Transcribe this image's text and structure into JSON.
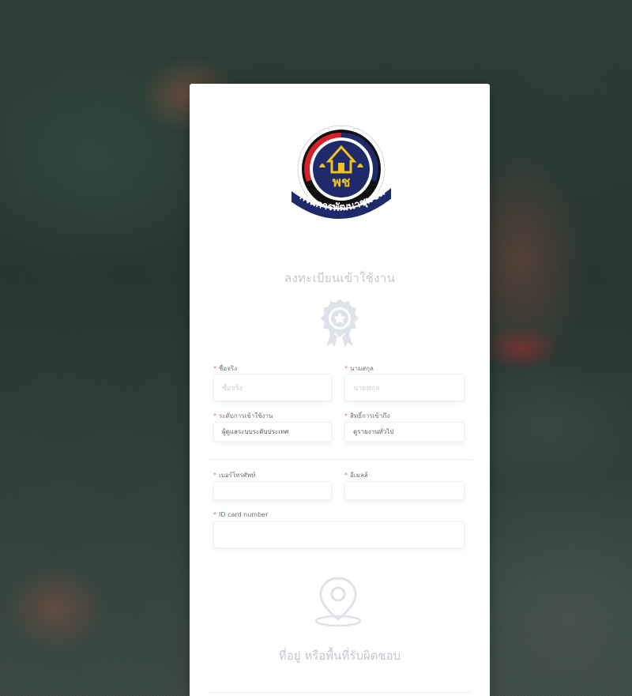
{
  "logo": {
    "text": "กรมการพัฒนาชุมชน",
    "emblem_text": "พช",
    "colors": {
      "navy": "#1f2a6b",
      "red": "#d8202a",
      "gold": "#f3c21a",
      "black": "#111111"
    }
  },
  "register_title": "ลงทะเบียนเข้าใช้งาน",
  "icons": {
    "award": "award-ribbon-icon",
    "location": "map-pin-icon"
  },
  "form": {
    "first_name": {
      "label": "ชื่อจริง",
      "placeholder": "ชื่อจริง",
      "required": "*"
    },
    "last_name": {
      "label": "นามสกุล",
      "placeholder": "นามสกุล",
      "required": "*"
    },
    "access_level": {
      "label": "ระดับการเข้าใช้งาน",
      "value": "ผู้ดูแลระบบระดับประเทศ",
      "required": "*"
    },
    "access_rights": {
      "label": "สิทธิ์การเข้าถึง",
      "value": "ดูรายงานทั่วไป",
      "required": "*"
    },
    "phone": {
      "label": "เบอร์โทรศัพท์",
      "value": "",
      "required": "*"
    },
    "email": {
      "label": "อีเมลล์",
      "value": "",
      "required": "*"
    },
    "id_card": {
      "label": "ID card number",
      "value": "",
      "required": "*"
    }
  },
  "address_title": "ที่อยู่ หรือพื้นที่รับผิดชอบ",
  "colors": {
    "muted_title": "#c3c7cf",
    "required_star": "#ef6b6b",
    "label": "#6b6f78",
    "icon": "#dfe2e8"
  }
}
